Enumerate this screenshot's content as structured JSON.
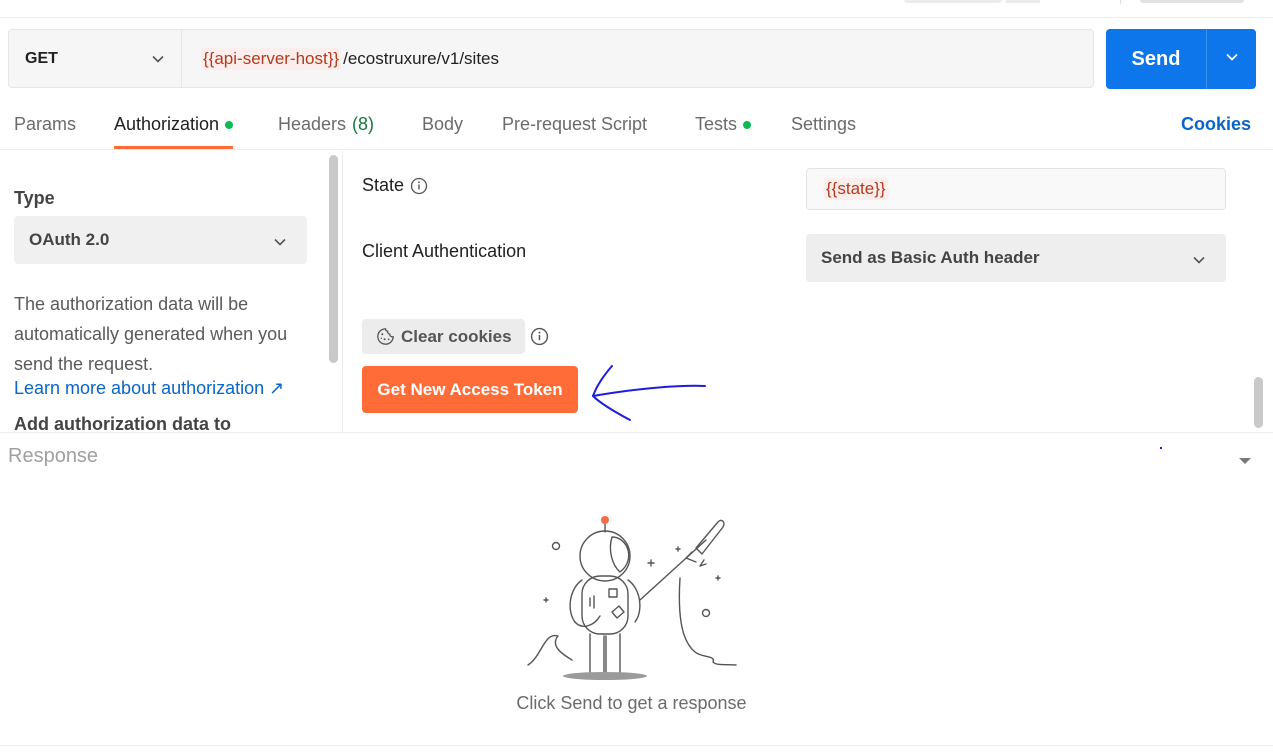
{
  "request": {
    "method": "GET",
    "url_variable": "{{api-server-host}}",
    "url_path": "/ecostruxure/v1/sites",
    "send_label": "Send"
  },
  "tabs": [
    {
      "label": "Params"
    },
    {
      "label": "Authorization",
      "status": "dot"
    },
    {
      "label": "Headers",
      "count": "(8)"
    },
    {
      "label": "Body"
    },
    {
      "label": "Pre-request Script"
    },
    {
      "label": "Tests",
      "status": "dot"
    },
    {
      "label": "Settings"
    }
  ],
  "cookies_label": "Cookies",
  "auth": {
    "type_label": "Type",
    "type_value": "OAuth 2.0",
    "description": "The authorization data will be automatically generated when you send the request.",
    "learn_more": "Learn more about authorization ↗",
    "add_auth_label": "Add authorization data to"
  },
  "config": {
    "state_label": "State",
    "state_value": "{{state}}",
    "client_auth_label": "Client Authentication",
    "client_auth_value": "Send as Basic Auth header",
    "clear_cookies": "Clear cookies",
    "get_token": "Get New Access Token"
  },
  "response": {
    "title": "Response",
    "empty_message": "Click Send to get a response"
  },
  "colors": {
    "accent": "#ff6c37",
    "send_blue": "#0c76ea",
    "status_green": "#0cbb52",
    "variable_red": "#b23a1c",
    "link_blue": "#0b65c8",
    "annotation_blue": "#1d1de0"
  }
}
